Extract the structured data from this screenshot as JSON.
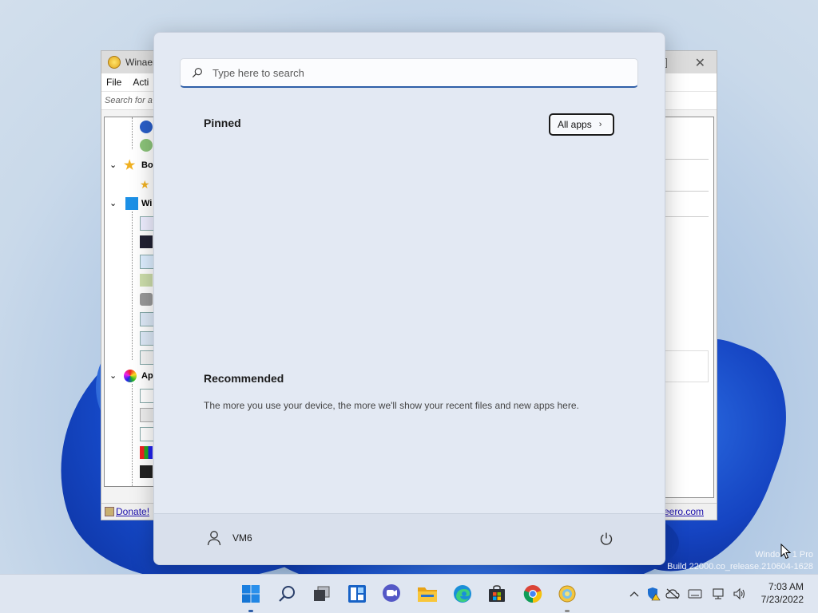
{
  "background_window": {
    "title": "Winaer",
    "menu": [
      "File",
      "Acti"
    ],
    "search_placeholder": "Search for a",
    "tree_nodes": [
      "Bo",
      "Wi",
      "Ap"
    ],
    "status_left": "Donate!",
    "status_right": "eero.com"
  },
  "start_menu": {
    "search": {
      "placeholder": "Type here to search"
    },
    "pinned": {
      "heading": "Pinned",
      "all_apps_label": "All apps"
    },
    "recommended": {
      "heading": "Recommended",
      "message": "The more you use your device, the more we'll show your recent files and new apps here."
    },
    "user": {
      "name": "VM6"
    }
  },
  "watermark": {
    "line1": "Windo     1 Pro",
    "line2": "Build 22000.co_release.210604-1628"
  },
  "taskbar": {
    "apps": [
      "start-icon",
      "search-icon",
      "task-view-icon",
      "widgets-icon",
      "chat-icon",
      "file-explorer-icon",
      "edge-icon",
      "store-icon",
      "chrome-icon",
      "winaero-tweaker-icon"
    ],
    "clock": {
      "time": "7:03 AM",
      "date": "7/23/2022"
    }
  },
  "colors": {
    "accent": "#2f5fa8",
    "start_bg": "#e3e9f3",
    "taskbar_bg": "#dfe6f1"
  }
}
